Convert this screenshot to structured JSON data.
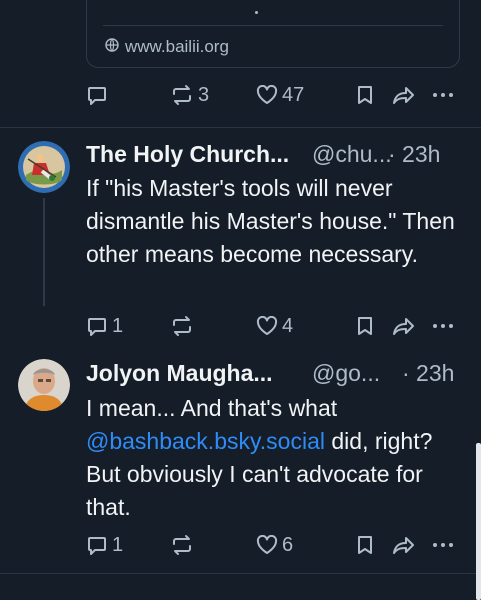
{
  "top_post": {
    "link_domain": "www.bailii.org",
    "reply_count": "",
    "repost_count": "3",
    "like_count": "47"
  },
  "posts": [
    {
      "author_name": "The Holy Church...",
      "handle": "@chu...",
      "time": "· 23h",
      "text": "If \"his Master's tools will never dismantle his Master's house.\" Then other means become necessary.",
      "reply_count": "1",
      "repost_count": "",
      "like_count": "4"
    },
    {
      "author_name": "Jolyon Maugha...",
      "handle": "@go...",
      "time": "· 23h",
      "text_before": "I mean... And that's what ",
      "mention": "@bashback.bsky.social",
      "text_after": " did, right? But obviously I can't advocate for that.",
      "reply_count": "1",
      "repost_count": "",
      "like_count": "6"
    }
  ],
  "icons": {
    "globe": "globe-icon",
    "reply": "reply-icon",
    "repost": "repost-icon",
    "like": "heart-icon",
    "bookmark": "bookmark-icon",
    "share": "share-icon",
    "more": "more-icon"
  },
  "colors": {
    "background": "#151d28",
    "text": "#f1f3f5",
    "muted": "#aebbc9",
    "mention": "#2f8cf6",
    "border": "#2e3a4a"
  }
}
